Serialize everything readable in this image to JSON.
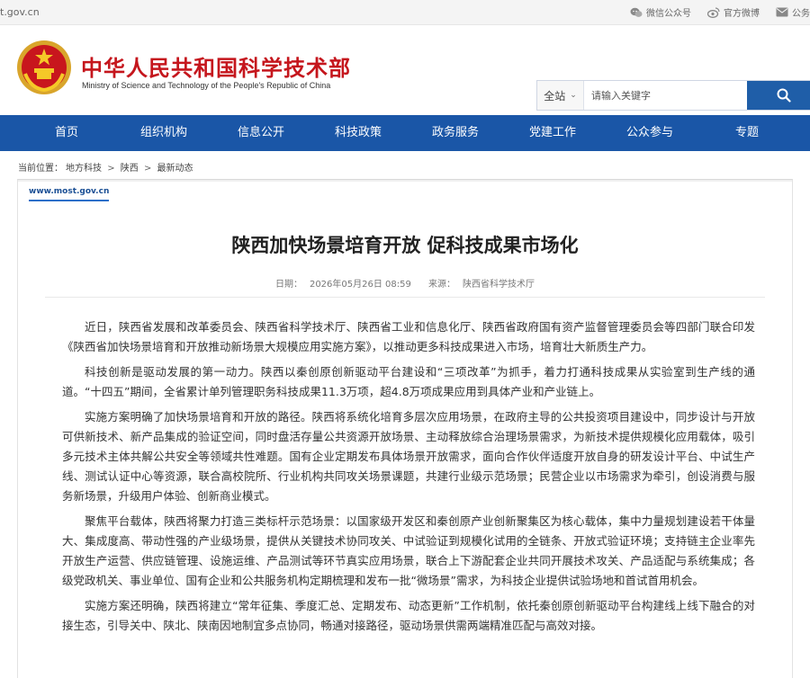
{
  "topbar": {
    "domain": "t.gov.cn",
    "links": [
      {
        "icon": "wechat-icon",
        "label": "微信公众号"
      },
      {
        "icon": "weibo-icon",
        "label": "官方微博"
      },
      {
        "icon": "mail-icon",
        "label": "公务"
      }
    ]
  },
  "header": {
    "title": "中华人民共和国科学技术部",
    "subtitle": "Ministry of Science and Technology of the People's Republic of China"
  },
  "search": {
    "scope": "全站",
    "placeholder": "请输入关键字"
  },
  "nav": [
    "首页",
    "组织机构",
    "信息公开",
    "科技政策",
    "政务服务",
    "党建工作",
    "公众参与",
    "专题"
  ],
  "breadcrumb": {
    "prefix": "当前位置：",
    "items": [
      "地方科技",
      "陕西",
      "最新动态"
    ],
    "separator": ">"
  },
  "article": {
    "watermark": "www.most.gov.cn",
    "title": "陕西加快场景培育开放 促科技成果市场化",
    "date_label": "日期：",
    "date": "2026年05月26日 08:59",
    "source_label": "来源：",
    "source": "陕西省科学技术厅",
    "paragraphs": [
      "近日，陕西省发展和改革委员会、陕西省科学技术厅、陕西省工业和信息化厅、陕西省政府国有资产监督管理委员会等四部门联合印发《陕西省加快场景培育和开放推动新场景大规模应用实施方案》，以推动更多科技成果进入市场，培育壮大新质生产力。",
      "科技创新是驱动发展的第一动力。陕西以秦创原创新驱动平台建设和“三项改革”为抓手，着力打通科技成果从实验室到生产线的通道。“十四五”期间，全省累计单列管理职务科技成果11.3万项，超4.8万项成果应用到具体产业和产业链上。",
      "实施方案明确了加快场景培育和开放的路径。陕西将系统化培育多层次应用场景，在政府主导的公共投资项目建设中，同步设计与开放可供新技术、新产品集成的验证空间，同时盘活存量公共资源开放场景、主动释放综合治理场景需求，为新技术提供规模化应用载体，吸引多元技术主体共解公共安全等领域共性难题。国有企业定期发布具体场景开放需求，面向合作伙伴适度开放自身的研发设计平台、中试生产线、测试认证中心等资源，联合高校院所、行业机构共同攻关场景课题，共建行业级示范场景；民营企业以市场需求为牵引，创设消费与服务新场景，升级用户体验、创新商业模式。",
      "聚焦平台载体，陕西将聚力打造三类标杆示范场景：以国家级开发区和秦创原产业创新聚集区为核心载体，集中力量规划建设若干体量大、集成度高、带动性强的产业级场景，提供从关键技术协同攻关、中试验证到规模化试用的全链条、开放式验证环境；支持链主企业率先开放生产运营、供应链管理、设施运维、产品测试等环节真实应用场景，联合上下游配套企业共同开展技术攻关、产品适配与系统集成；各级党政机关、事业单位、国有企业和公共服务机构定期梳理和发布一批“微场景”需求，为科技企业提供试验场地和首试首用机会。",
      "实施方案还明确，陕西将建立“常年征集、季度汇总、定期发布、动态更新”工作机制，依托秦创原创新驱动平台构建线上线下融合的对接生态，引导关中、陕北、陕南因地制宜多点协同，畅通对接路径，驱动场景供需两端精准匹配与高效对接。"
    ]
  }
}
